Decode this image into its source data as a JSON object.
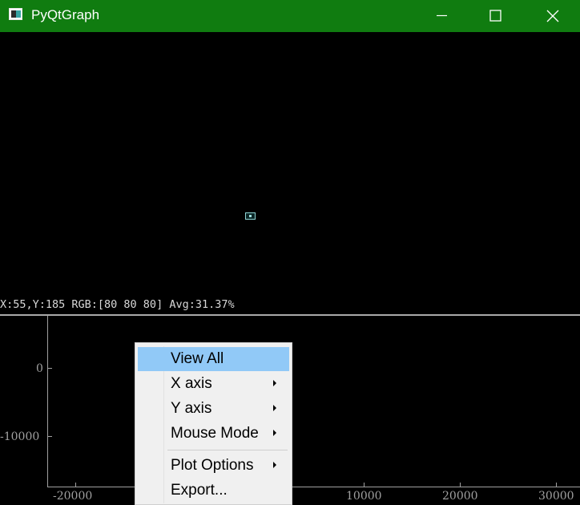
{
  "window": {
    "title": "PyQtGraph"
  },
  "title_buttons": {
    "minimize_icon": "minimize-icon",
    "maximize_icon": "maximize-icon",
    "close_icon": "close-icon"
  },
  "status": {
    "readout": "X:55,Y:185 RGB:[80 80 80] Avg:31.37%"
  },
  "plot": {
    "y_ticks": [
      "0",
      "-10000"
    ],
    "x_ticks": [
      "-20000",
      "10000",
      "20000",
      "30000"
    ]
  },
  "menu": {
    "items": [
      {
        "label": "View All",
        "submenu": false
      },
      {
        "label": "X axis",
        "submenu": true
      },
      {
        "label": "Y axis",
        "submenu": true
      },
      {
        "label": "Mouse Mode",
        "submenu": true
      },
      {
        "label": "Plot Options",
        "submenu": true
      },
      {
        "label": "Export...",
        "submenu": false
      }
    ]
  },
  "colors": {
    "titlebar": "#107c10",
    "menu_highlight": "#91c9f7",
    "axis": "#a0a0a0"
  }
}
